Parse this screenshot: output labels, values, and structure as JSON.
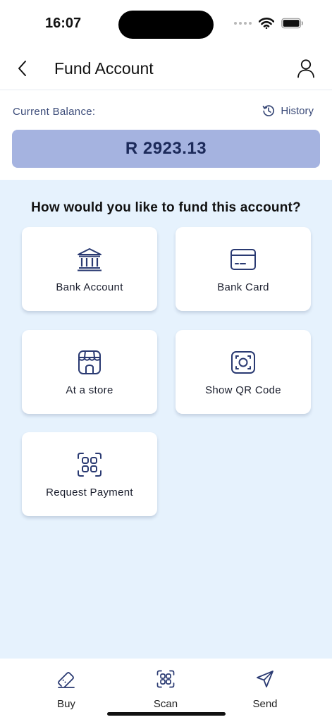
{
  "status_bar": {
    "time": "16:07"
  },
  "header": {
    "title": "Fund Account"
  },
  "balance": {
    "label": "Current Balance:",
    "history_label": "History",
    "value": "R 2923.13"
  },
  "main": {
    "question": "How would you like to fund this account?",
    "options": [
      {
        "label": "Bank Account",
        "icon": "bank-icon"
      },
      {
        "label": "Bank Card",
        "icon": "card-icon"
      },
      {
        "label": "At a store",
        "icon": "store-icon"
      },
      {
        "label": "Show QR Code",
        "icon": "qr-frame-icon"
      },
      {
        "label": "Request Payment",
        "icon": "request-grid-icon"
      }
    ]
  },
  "bottom_nav": {
    "items": [
      {
        "label": "Buy",
        "icon": "voucher-icon"
      },
      {
        "label": "Scan",
        "icon": "scan-icon"
      },
      {
        "label": "Send",
        "icon": "send-icon"
      }
    ]
  },
  "colors": {
    "accent": "#1c2a5a",
    "balance_box": "#a5b3e0",
    "content_bg": "#e6f2fd",
    "icon": "#2a3a72"
  }
}
